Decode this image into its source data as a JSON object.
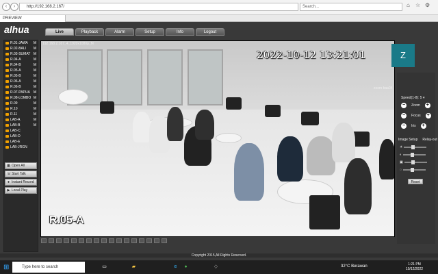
{
  "browser": {
    "address": "http://192.168.2.167/",
    "search_placeholder": "Search...",
    "tab_title": "PREVIEW"
  },
  "app": {
    "logo": "alhua",
    "tabs": [
      "Live",
      "Playback",
      "Alarm",
      "Setup",
      "Info",
      "Logout"
    ],
    "active_tab": "Live",
    "copyright": "Copyright 2015,All Rights Reserved."
  },
  "sidebar": {
    "channels": [
      {
        "label": "R.01-JAWA",
        "marker": "M"
      },
      {
        "label": "R.02-BALI",
        "marker": "M"
      },
      {
        "label": "R.03-SUMAT",
        "marker": "M"
      },
      {
        "label": "R.04-A",
        "marker": "M"
      },
      {
        "label": "R.04-B",
        "marker": "M"
      },
      {
        "label": "R.05-A",
        "marker": "M"
      },
      {
        "label": "R.05-B",
        "marker": "M"
      },
      {
        "label": "R.06-A",
        "marker": "M"
      },
      {
        "label": "R.06-B",
        "marker": "M"
      },
      {
        "label": "R.07-PAPUA",
        "marker": "M"
      },
      {
        "label": "R.08-LOMBO",
        "marker": "M"
      },
      {
        "label": "R.09",
        "marker": "M"
      },
      {
        "label": "R.10",
        "marker": "M"
      },
      {
        "label": "R.11",
        "marker": "M"
      },
      {
        "label": "LAB-A",
        "marker": "M"
      },
      {
        "label": "LAB-B",
        "marker": "M"
      },
      {
        "label": "LAB-C",
        "marker": ""
      },
      {
        "label": "LAB-D",
        "marker": ""
      },
      {
        "label": "LAB-E",
        "marker": ""
      },
      {
        "label": "LAB-JRGN",
        "marker": ""
      }
    ],
    "buttons": [
      "Open All",
      "Start Talk",
      "Instant Record",
      "Local Play"
    ]
  },
  "video": {
    "stream_info": "192.168.2.167_4_1920x1080p_M",
    "timestamp": "2022-10-12 13:21:01",
    "room_label": "R.05-A"
  },
  "zoom": {
    "avatar_letter": "Z",
    "user_label": "zoom baa04"
  },
  "ptz": {
    "speed_label": "Speed(1-8):",
    "speed_value": "5",
    "controls": [
      "Zoom",
      "Focus",
      "Iris"
    ],
    "setup_tabs": [
      "Image Setup",
      "Relay-out"
    ],
    "reset": "Reset",
    "adjustment_levels": [
      0.38,
      0.38,
      0.38,
      0.38
    ]
  },
  "taskbar": {
    "search_placeholder": "Type here to search",
    "weather": "32°C Berawan",
    "time": "1:21 PM",
    "date": "10/12/2022"
  },
  "colors": {
    "app_background": "#393939",
    "channel_icon": "#f0a000",
    "zoom_avatar": "#1a7a88"
  }
}
